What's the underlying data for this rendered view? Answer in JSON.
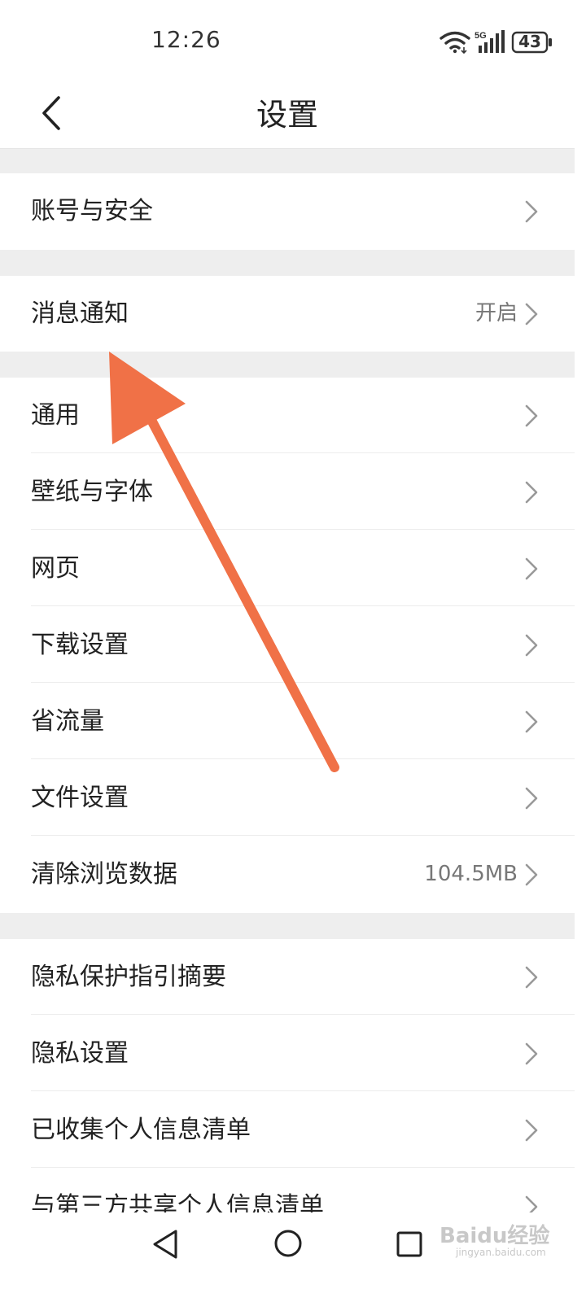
{
  "status_bar": {
    "time": "12:26",
    "network": "5G",
    "battery": "43"
  },
  "header": {
    "title": "设置"
  },
  "groups": [
    {
      "items": [
        {
          "label": "账号与安全",
          "value": ""
        }
      ]
    },
    {
      "items": [
        {
          "label": "消息通知",
          "value": "开启"
        }
      ]
    },
    {
      "items": [
        {
          "label": "通用",
          "value": ""
        },
        {
          "label": "壁纸与字体",
          "value": ""
        },
        {
          "label": "网页",
          "value": ""
        },
        {
          "label": "下载设置",
          "value": ""
        },
        {
          "label": "省流量",
          "value": ""
        },
        {
          "label": "文件设置",
          "value": ""
        },
        {
          "label": "清除浏览数据",
          "value": "104.5MB"
        }
      ]
    },
    {
      "items": [
        {
          "label": "隐私保护指引摘要",
          "value": ""
        },
        {
          "label": "隐私设置",
          "value": ""
        },
        {
          "label": "已收集个人信息清单",
          "value": ""
        },
        {
          "label": "与第三方共享个人信息清单",
          "value": ""
        }
      ]
    }
  ],
  "watermark": {
    "text": "Baidu经验",
    "sub": "jingyan.baidu.com"
  },
  "colors": {
    "annotation_arrow": "#F07147",
    "group_gap": "#eeeeee"
  },
  "icons": [
    "wifi-icon",
    "signal-icon",
    "battery-icon",
    "back-icon",
    "chevron-right-icon",
    "nav-back-icon",
    "nav-home-icon",
    "nav-recent-icon"
  ]
}
